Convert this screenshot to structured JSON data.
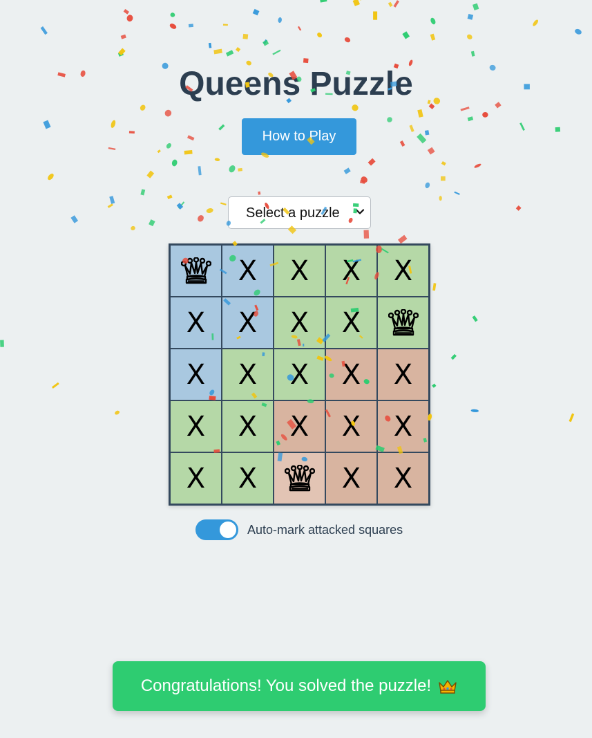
{
  "title": "Queens Puzzle",
  "how_to_play_label": "How to Play",
  "puzzle_select": {
    "selected": "Select a puzzle"
  },
  "colors": {
    "background": "#ecf0f1",
    "accent": "#3498db",
    "success": "#2ecc71",
    "board_border": "#34495e",
    "region_blue": "#a9c8e0",
    "region_green": "#b5d8a7",
    "region_orange": "#d8b4a0",
    "highlight_orange": "#e2c4b4"
  },
  "board": {
    "size": 5,
    "cells": [
      [
        {
          "region": "blue",
          "mark": "queen"
        },
        {
          "region": "blue",
          "mark": "X"
        },
        {
          "region": "green",
          "mark": "X"
        },
        {
          "region": "green",
          "mark": "X"
        },
        {
          "region": "green",
          "mark": "X"
        }
      ],
      [
        {
          "region": "blue",
          "mark": "X"
        },
        {
          "region": "blue",
          "mark": "X"
        },
        {
          "region": "green",
          "mark": "X"
        },
        {
          "region": "green",
          "mark": "X"
        },
        {
          "region": "green",
          "mark": "queen"
        }
      ],
      [
        {
          "region": "blue",
          "mark": "X"
        },
        {
          "region": "green",
          "mark": "X"
        },
        {
          "region": "green",
          "mark": "X"
        },
        {
          "region": "orange",
          "mark": "X"
        },
        {
          "region": "orange",
          "mark": "X"
        }
      ],
      [
        {
          "region": "green",
          "mark": "X"
        },
        {
          "region": "green",
          "mark": "X"
        },
        {
          "region": "orange",
          "mark": "X"
        },
        {
          "region": "orange",
          "mark": "X"
        },
        {
          "region": "orange",
          "mark": "X"
        }
      ],
      [
        {
          "region": "green",
          "mark": "X"
        },
        {
          "region": "green",
          "mark": "X"
        },
        {
          "region": "highlight_orange",
          "mark": "queen"
        },
        {
          "region": "orange",
          "mark": "X"
        },
        {
          "region": "orange",
          "mark": "X"
        }
      ]
    ]
  },
  "auto_mark": {
    "label": "Auto-mark attacked squares",
    "enabled": true
  },
  "toast": {
    "message": "Congratulations! You solved the puzzle!",
    "icon": "crown-icon"
  },
  "confetti_colors": [
    "#e74c3c",
    "#3498db",
    "#2ecc71",
    "#f1c40f"
  ]
}
